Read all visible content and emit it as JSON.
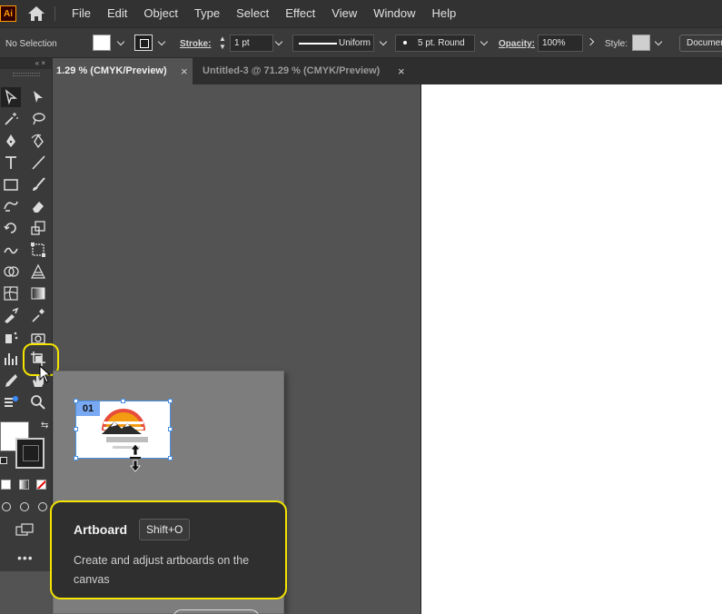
{
  "app": {
    "logo_text": "Ai",
    "menu": [
      "File",
      "Edit",
      "Object",
      "Type",
      "Select",
      "Effect",
      "View",
      "Window",
      "Help"
    ]
  },
  "control_bar": {
    "selection_label": "No Selection",
    "stroke_label": "Stroke:",
    "stroke_weight": "1 pt",
    "stroke_profile": "Uniform",
    "brush": "5 pt. Round",
    "opacity_label": "Opacity:",
    "opacity_value": "100%",
    "style_label": "Style:",
    "document_button": "Documen"
  },
  "tabs": [
    {
      "label": "1.29 % (CMYK/Preview)",
      "active": true
    },
    {
      "label": "Untitled-3 @ 71.29 % (CMYK/Preview)",
      "active": false
    }
  ],
  "toolbar": {
    "collapse_glyph": "«"
  },
  "tooltip": {
    "artboard_number": "01",
    "title": "Artboard",
    "shortcut": "Shift+O",
    "description": "Create and adjust artboards on the canvas"
  },
  "colors": {
    "highlight": "#f4e400",
    "artboard_blue": "#4a90e2",
    "logo_orange": "#ff9a00"
  }
}
